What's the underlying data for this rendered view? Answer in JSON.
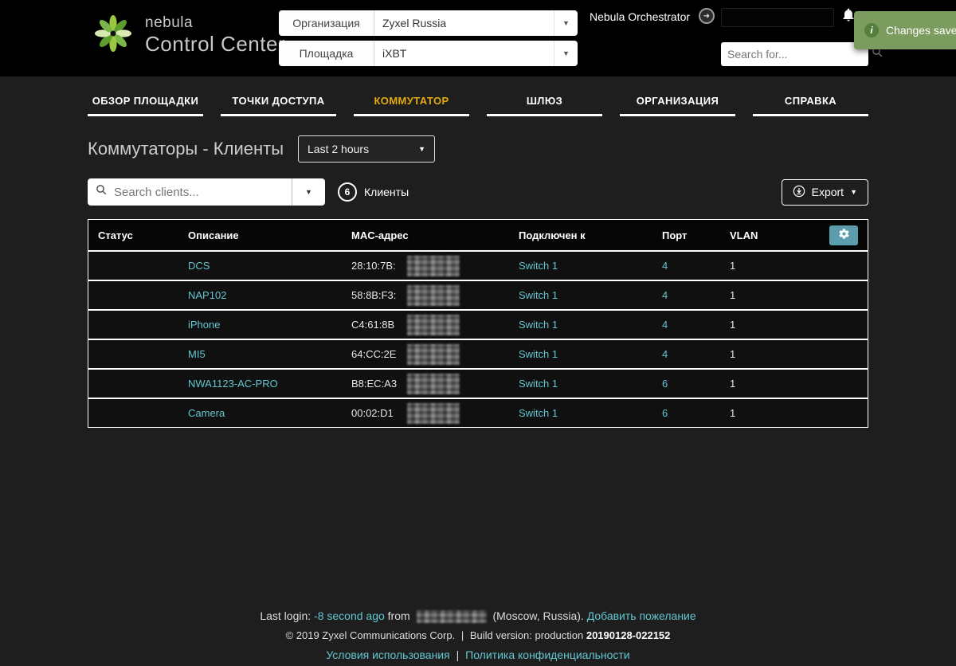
{
  "brand": {
    "line1": "nebula",
    "line2": "Control Center"
  },
  "header": {
    "org_label": "Организация",
    "org_value": "Zyxel Russia",
    "site_label": "Площадка",
    "site_value": "iXBT",
    "orchestrator_label": "Nebula Orchestrator",
    "search_placeholder": "Search for..."
  },
  "toast": {
    "text": "Changes saved",
    "icon": "i"
  },
  "nav": {
    "tabs": [
      {
        "label": "ОБЗОР ПЛОЩАДКИ"
      },
      {
        "label": "ТОЧКИ ДОСТУПА"
      },
      {
        "label": "КОММУТАТОР"
      },
      {
        "label": "ШЛЮЗ"
      },
      {
        "label": "ОРГАНИЗАЦИЯ"
      },
      {
        "label": "СПРАВКА"
      }
    ]
  },
  "page": {
    "title": "Коммутаторы - Клиенты",
    "time_range": "Last 2 hours",
    "search_placeholder": "Search clients...",
    "clients_count": "6",
    "clients_label": "Клиенты",
    "export_label": "Export"
  },
  "table": {
    "headers": {
      "status": "Статус",
      "description": "Описание",
      "mac": "MAC-адрес",
      "connected": "Подключен к",
      "port": "Порт",
      "vlan": "VLAN"
    },
    "rows": [
      {
        "description": "DCS",
        "mac_prefix": "28:10:7B:",
        "connected": "Switch 1",
        "port": "4",
        "vlan": "1"
      },
      {
        "description": "NAP102",
        "mac_prefix": "58:8B:F3:",
        "connected": "Switch 1",
        "port": "4",
        "vlan": "1"
      },
      {
        "description": "iPhone",
        "mac_prefix": "C4:61:8B",
        "connected": "Switch 1",
        "port": "4",
        "vlan": "1"
      },
      {
        "description": "MI5",
        "mac_prefix": "64:CC:2E",
        "connected": "Switch 1",
        "port": "4",
        "vlan": "1"
      },
      {
        "description": "NWA1123-AC-PRO",
        "mac_prefix": "B8:EC:A3",
        "connected": "Switch 1",
        "port": "6",
        "vlan": "1"
      },
      {
        "description": "Camera",
        "mac_prefix": "00:02:D1",
        "connected": "Switch 1",
        "port": "6",
        "vlan": "1"
      }
    ]
  },
  "footer": {
    "last_login_label": "Last login:",
    "last_login_value": "-8 second ago",
    "from_word": "from",
    "location": "(Moscow, Russia).",
    "wish_link": "Добавить пожелание",
    "copyright": "© 2019 Zyxel Communications Corp.",
    "separator": "|",
    "build_label": "Build version:",
    "build_mode": "production",
    "build_number": "20190128-022152",
    "terms_link": "Условия использования",
    "privacy_link": "Политика конфиденциальности"
  },
  "icons": {
    "caret_down": "▼"
  },
  "colors": {
    "link": "#63c6d0",
    "active_tab": "#e3ab10",
    "status_online": "#38c40f",
    "toast_bg": "#7c9b5e",
    "gear_button_bg": "#5b9dac",
    "brand_green": "#7ab648"
  }
}
